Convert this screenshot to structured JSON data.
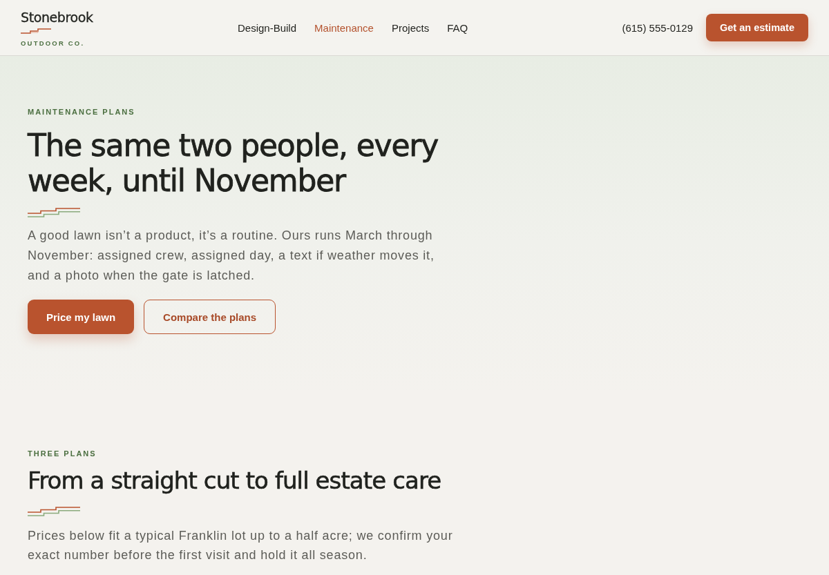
{
  "header": {
    "logo": {
      "name": "Stonebrook",
      "tagline": "OUTDOOR CO."
    },
    "nav": [
      {
        "label": "Design-Build",
        "selected": false
      },
      {
        "label": "Maintenance",
        "selected": true
      },
      {
        "label": "Projects",
        "selected": false
      },
      {
        "label": "FAQ",
        "selected": false
      }
    ],
    "phone": "(615) 555-0129",
    "cta": "Get an estimate"
  },
  "hero": {
    "eyebrow": "MAINTENANCE PLANS",
    "title": "The same two people, every week, until November",
    "intro": "A good lawn isn’t a product, it’s a routine. Ours runs March through November: assigned crew, assigned day, a text if weather moves it, and a photo when the gate is latched.",
    "buttons": [
      {
        "label": "Price my lawn",
        "kind": "primary"
      },
      {
        "label": "Compare the plans",
        "kind": "secondary"
      }
    ]
  },
  "plans_section": {
    "eyebrow": "THREE PLANS",
    "title": "From a straight cut to full estate care",
    "intro": "Prices below fit a typical Franklin lot up to a half acre; we confirm your exact number before the first visit and hold it all season."
  }
}
